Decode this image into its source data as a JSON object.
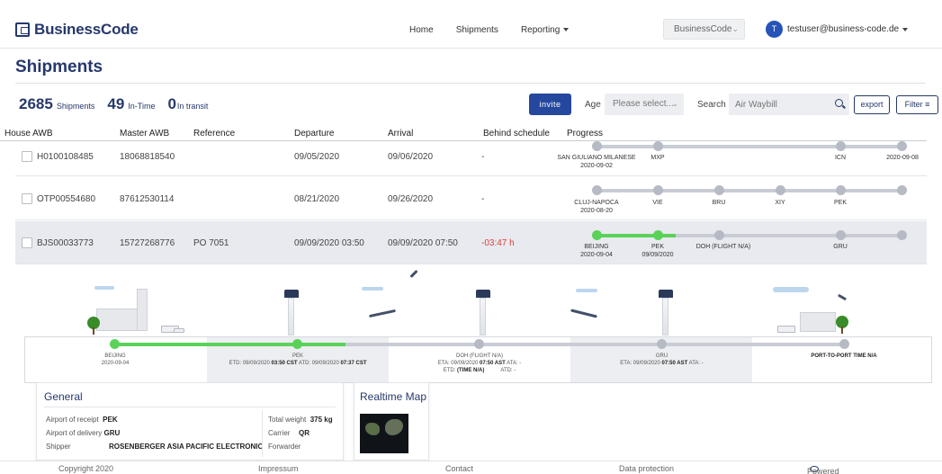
{
  "brand": {
    "name": "BusinessCode"
  },
  "nav": {
    "home": "Home",
    "shipments": "Shipments",
    "reporting": "Reporting"
  },
  "company_select": {
    "value": "BusinessCode"
  },
  "user": {
    "initial": "T",
    "email": "testuser@business-code.de"
  },
  "page": {
    "title": "Shipments"
  },
  "stats": {
    "shipments_count": "2685",
    "shipments_label": "Shipments",
    "intime_count": "49",
    "intime_label": "In-Time",
    "transit_count": "0",
    "transit_label": "In transit"
  },
  "toolbar": {
    "invite_label": "invite",
    "age_label": "Age",
    "age_value": "Please select...",
    "search_label": "Search",
    "search_placeholder": "Air Waybill",
    "export_label": "export",
    "filter_label": "Filter"
  },
  "table": {
    "headers": [
      "House AWB",
      "Master AWB",
      "Reference",
      "Departure",
      "Arrival",
      "Behind schedule",
      "Progress"
    ],
    "rows": [
      {
        "house_awb": "H0100108485",
        "master_awb": "18068818540",
        "reference": "",
        "departure": "09/05/2020",
        "arrival": "09/06/2020",
        "behind": "-",
        "stops": [
          {
            "name": "SAN GIULIANO MILANESE",
            "date": "2020-09-02"
          },
          {
            "name": "MXP",
            "date": ""
          },
          {
            "name": "ICN",
            "date": ""
          },
          {
            "name": "",
            "date": "2020-09-08"
          }
        ]
      },
      {
        "house_awb": "OTP00554680",
        "master_awb": "87612530114",
        "reference": "",
        "departure": "08/21/2020",
        "arrival": "09/26/2020",
        "behind": "-",
        "stops": [
          {
            "name": "CLUJ-NAPOCA",
            "date": "2020-08-20"
          },
          {
            "name": "VIE",
            "date": ""
          },
          {
            "name": "BRU",
            "date": ""
          },
          {
            "name": "XIY",
            "date": ""
          },
          {
            "name": "PEK",
            "date": ""
          }
        ]
      },
      {
        "house_awb": "BJS00033773",
        "master_awb": "15727268776",
        "reference": "PO 7051",
        "departure": "09/09/2020 03:50",
        "arrival": "09/09/2020 07:50",
        "behind": "-03:47 h",
        "stops": [
          {
            "name": "BEIJING",
            "date": "2020-09-04"
          },
          {
            "name": "PEK",
            "date": "09/09/2020"
          },
          {
            "name": "DOH (FLIGHT N/A)",
            "date": ""
          },
          {
            "name": "GRU",
            "date": ""
          }
        ]
      }
    ]
  },
  "legs": {
    "beijing": {
      "name": "BEIJING",
      "date": "2020-09-04"
    },
    "pek": {
      "name": "PEK",
      "etd_prefix": "ETD: 09/09/2020 ",
      "etd_time": "03:50",
      "etd_tz": " CST",
      "atd_prefix": " ATD: 09/09/2020 ",
      "atd_time": "07:37",
      "atd_tz": " CST"
    },
    "doh": {
      "name": "DOH (FLIGHT N/A)",
      "line2_prefix": "ETA: 09/09/2020 ",
      "line2_time": "07:50",
      "line2_tz": " AST",
      "line2_suffix": " ATA: -",
      "line3_prefix": "ETD: ",
      "line3_bold": "(TIME N/A)",
      "line3_suffix": "           ATD: -"
    },
    "gru": {
      "name": "GRU",
      "eta_prefix": "ETA: 09/09/2020 ",
      "eta_time": "07:50",
      "eta_tz": " AST",
      "ata": " ATA: -"
    },
    "p2p": {
      "label": "PORT-TO-PORT TIME N/A"
    }
  },
  "general": {
    "title": "General",
    "receipt_label": "Airport of receipt",
    "receipt_value": "PEK",
    "delivery_label": "Airport of delivery",
    "delivery_value": "GRU",
    "shipper_label": "Shipper",
    "shipper_value": "ROSENBERGER ASIA PACIFIC ELECTRONIC",
    "weight_label": "Total weight",
    "weight_value": "375 kg",
    "carrier_label": "Carrier",
    "carrier_value": "QR",
    "forwarder_label": "Forwarder",
    "forwarder_value": ""
  },
  "realtime_map": {
    "title": "Realtime Map"
  },
  "footer": {
    "copyright": "Copyright 2020",
    "impressum": "Impressum",
    "contact": "Contact",
    "data_protection": "Data protection",
    "powered": "Powered by"
  },
  "colors": {
    "brand": "#26386b",
    "accent_button": "#26479e",
    "progress_done": "#5ad25a",
    "progress_pending": "#b6bac4",
    "late": "#d9403a"
  }
}
